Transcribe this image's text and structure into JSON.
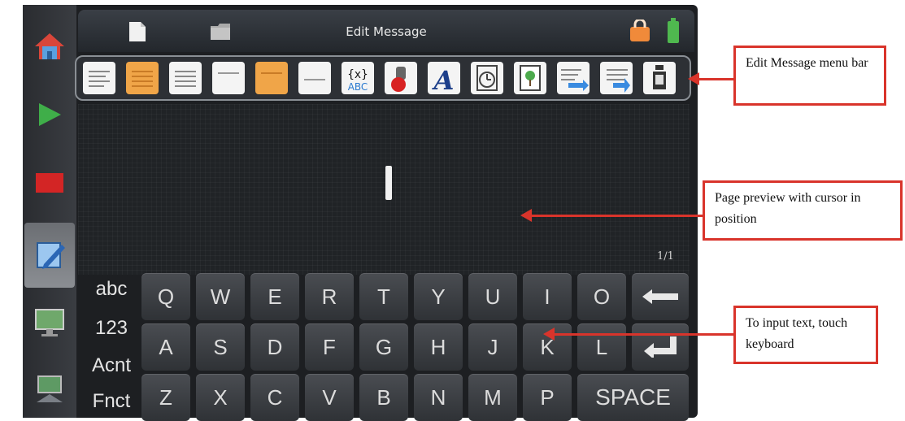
{
  "header": {
    "title": "Edit Message"
  },
  "toolbar": {
    "icons": [
      "text-align-left-icon",
      "text-block-orange-icon",
      "text-lines-icon",
      "page-icon",
      "page-orange-icon",
      "line-icon",
      "variable-icon",
      "stamp-icon",
      "font-icon",
      "clock-icon",
      "image-icon",
      "align-left-arrow-icon",
      "align-right-arrow-icon",
      "bottle-icon"
    ]
  },
  "preview": {
    "page_indicator": "1/1"
  },
  "keyboard": {
    "modes": [
      "abc",
      "123",
      "Acnt",
      "Fnct"
    ],
    "row1": [
      "Q",
      "W",
      "E",
      "R",
      "T",
      "Y",
      "U",
      "I",
      "O"
    ],
    "row2": [
      "A",
      "S",
      "D",
      "F",
      "G",
      "H",
      "J",
      "K",
      "L"
    ],
    "row3": [
      "Z",
      "X",
      "C",
      "V",
      "B",
      "N",
      "M",
      "P"
    ],
    "space_label": "SPACE",
    "backspace_icon": "backspace-arrow-icon",
    "enter_icon": "enter-arrow-icon"
  },
  "annotations": {
    "menu_bar": "Edit Message menu bar",
    "preview": "Page preview with cursor in position",
    "keyboard": "To input text, touch keyboard"
  },
  "colors": {
    "annotation": "#d9342b",
    "screen": "#1d1f22",
    "lock": "#f08a3a",
    "battery": "#4fb84f"
  }
}
